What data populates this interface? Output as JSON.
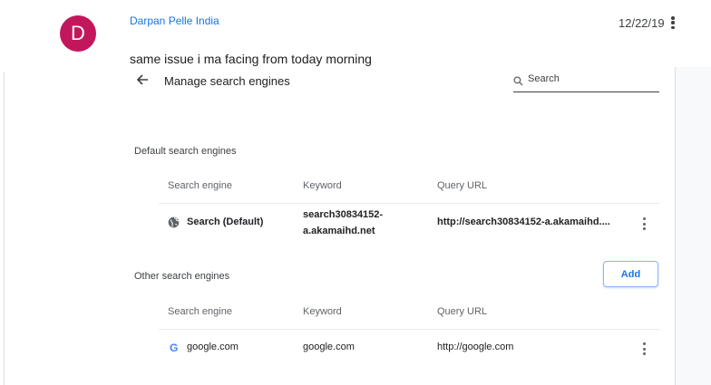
{
  "post": {
    "avatar_letter": "D",
    "avatar_color": "#c2185b",
    "author": "Darpan Pelle India",
    "date": "12/22/19",
    "menu_icon": "more-vert-icon",
    "body": "same issue i ma facing from today morning"
  },
  "settings": {
    "back_icon": "arrow-back-icon",
    "title": "Manage search engines",
    "search": {
      "icon": "search-icon",
      "placeholder": "Search",
      "value": ""
    },
    "default_section": {
      "label": "Default search engines",
      "columns": [
        "Search engine",
        "Keyword",
        "Query URL"
      ],
      "rows": [
        {
          "icon": "globe-icon",
          "name": "Search (Default)",
          "keyword_line1": "search30834152-",
          "keyword_line2": "a.akamaihd.net",
          "url": "http://search30834152-a.akamaihd....",
          "menu_icon": "more-vert-icon"
        }
      ]
    },
    "other_section": {
      "label": "Other search engines",
      "add_label": "Add",
      "columns": [
        "Search engine",
        "Keyword",
        "Query URL"
      ],
      "rows": [
        {
          "icon": "google-g-icon",
          "icon_glyph": "G",
          "name": "google.com",
          "keyword": "google.com",
          "url": "http://google.com",
          "menu_icon": "more-vert-icon"
        }
      ]
    },
    "accent_color": "#1a73e8"
  }
}
